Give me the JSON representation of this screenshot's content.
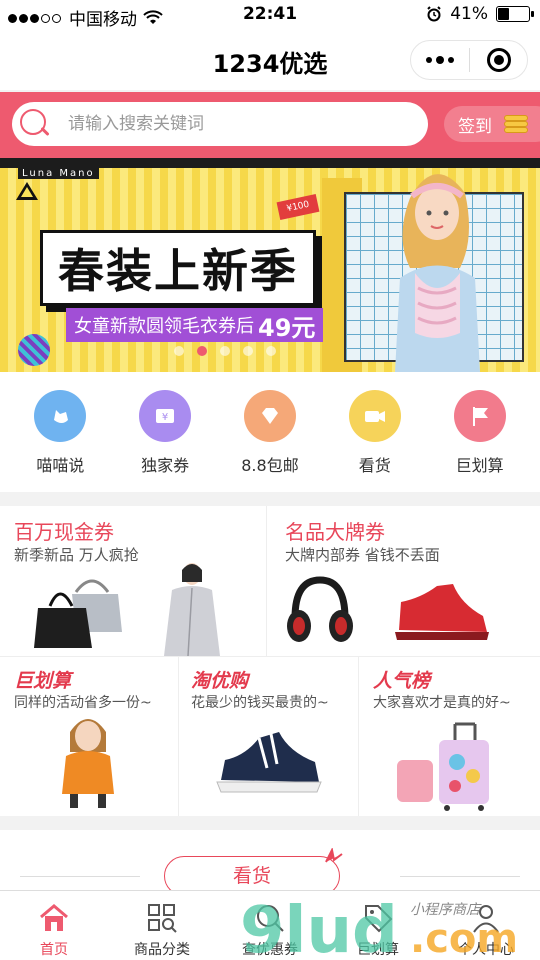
{
  "status_bar": {
    "carrier": "中国移动",
    "time": "22:41",
    "battery_percent": "41%",
    "battery_level": 0.41
  },
  "nav": {
    "title": "1234优选"
  },
  "search": {
    "placeholder": "请输入搜索关键词",
    "signin_label": "签到"
  },
  "banner": {
    "brand": "Luna Mano",
    "headline": "春装上新季",
    "subline": "女童新款圆领毛衣券后",
    "price": "49元",
    "price_tag": "¥100",
    "slide_count": 5,
    "active_slide": 2
  },
  "quick_links": [
    {
      "label": "喵喵说",
      "icon": "cat-icon",
      "color": "#6fb3f0"
    },
    {
      "label": "独家券",
      "icon": "ticket-icon",
      "color": "#a98cf0"
    },
    {
      "label": "8.8包邮",
      "icon": "diamond-icon",
      "color": "#f5a878"
    },
    {
      "label": "看货",
      "icon": "video-icon",
      "color": "#f6d35a"
    },
    {
      "label": "巨划算",
      "icon": "flag-icon",
      "color": "#f27b8c"
    }
  ],
  "promo": {
    "cash": {
      "title": "百万现金券",
      "subtitle": "新季新品 万人疯抢"
    },
    "brand": {
      "title": "名品大牌券",
      "subtitle": "大牌内部券 省钱不丢面"
    },
    "deal": {
      "title": "巨划算",
      "subtitle": "同样的活动省多一份~"
    },
    "taoyou": {
      "title": "淘优购",
      "subtitle": "花最少的钱买最贵的~"
    },
    "popular": {
      "title": "人气榜",
      "subtitle": "大家喜欢才是真的好~"
    }
  },
  "section": {
    "kanhuo_label": "看货"
  },
  "tabbar": [
    {
      "label": "首页",
      "icon": "home-icon",
      "active": true
    },
    {
      "label": "商品分类",
      "icon": "grid-search-icon",
      "active": false
    },
    {
      "label": "查优惠券",
      "icon": "coupon-search-icon",
      "active": false
    },
    {
      "label": "巨划算",
      "icon": "tag-icon",
      "active": false
    },
    {
      "label": "个人中心",
      "icon": "user-icon",
      "active": false
    }
  ],
  "watermark": {
    "text": "9lud.com",
    "tagline": "小程序商店"
  },
  "colors": {
    "accent": "#ee5a6f",
    "accent_text": "#e8475a"
  }
}
